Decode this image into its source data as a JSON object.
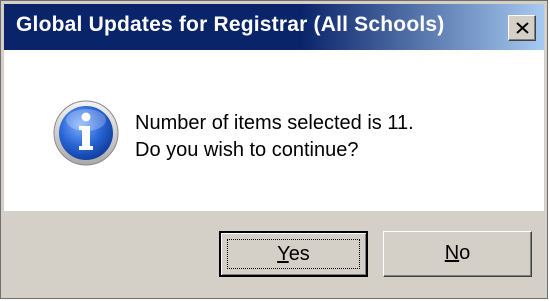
{
  "dialog": {
    "title": "Global Updates for Registrar (All Schools)",
    "message_line1": "Number of items selected is 11.",
    "message_line2": "Do you wish to continue?",
    "icon": "information-icon",
    "close_icon": "close-icon",
    "buttons": {
      "yes_mnemonic": "Y",
      "yes_rest": "es",
      "no_mnemonic": "N",
      "no_rest": "o"
    },
    "default_button": "Yes",
    "colors": {
      "title_start": "#0a246a",
      "title_end": "#a6caf0",
      "face": "#d4d0c8",
      "icon_blue": "#1f57c4"
    }
  }
}
